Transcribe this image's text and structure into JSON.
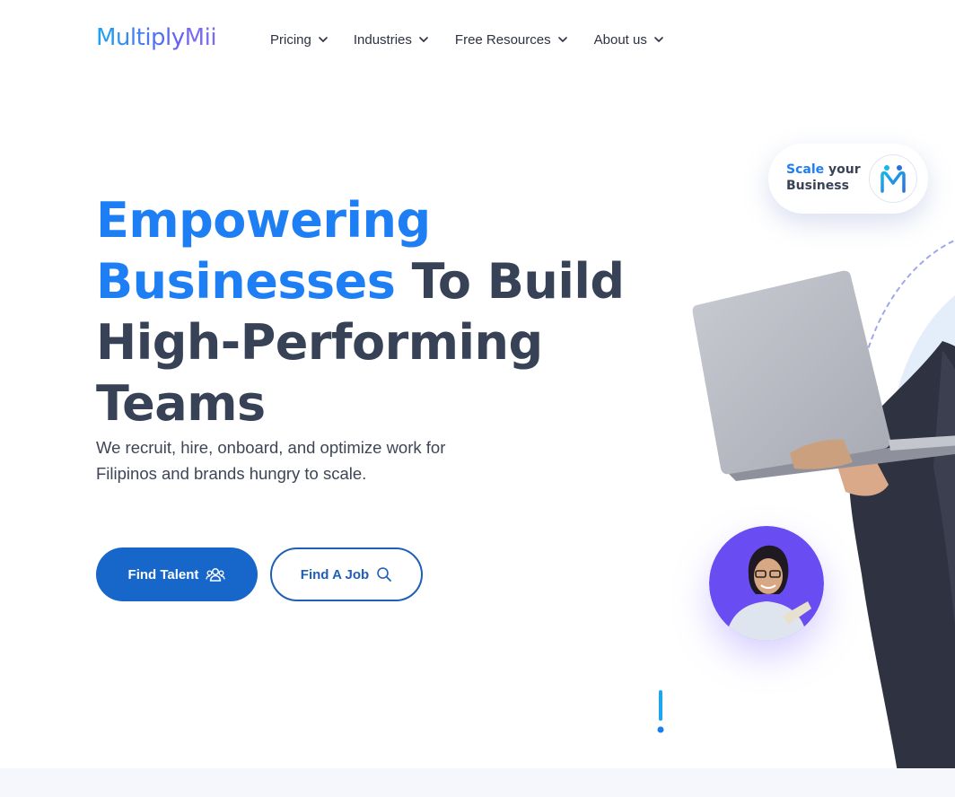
{
  "brand": {
    "logo_text_main": "Multiply",
    "logo_text_accent": "Mii"
  },
  "nav": {
    "items": [
      {
        "label": "Pricing"
      },
      {
        "label": "Industries"
      },
      {
        "label": "Free Resources"
      },
      {
        "label": "About us"
      }
    ]
  },
  "hero": {
    "headline_blue_1": "Empowering",
    "headline_blue_2": "Businesses",
    "headline_rest_1": " To Build",
    "headline_rest_2": "High-Performing",
    "headline_rest_3": "Teams",
    "subtext": "We recruit, hire, onboard, and optimize work for Filipinos and brands hungry to scale.",
    "primary_button": "Find Talent",
    "secondary_button": "Find A Job"
  },
  "scale_card": {
    "word_highlight": "Scale",
    "word_rest_1": " your",
    "word_rest_2": "Business"
  },
  "colors": {
    "accent_blue": "#1e7ff5",
    "heading_dark": "#374256",
    "button_blue": "#1766c9",
    "avatar_purple": "#6a4df2"
  },
  "icons": {
    "nav_chevron": "chevron-down-icon",
    "find_talent": "people-icon",
    "find_job": "search-icon",
    "badge": "multiplymii-m-icon"
  }
}
